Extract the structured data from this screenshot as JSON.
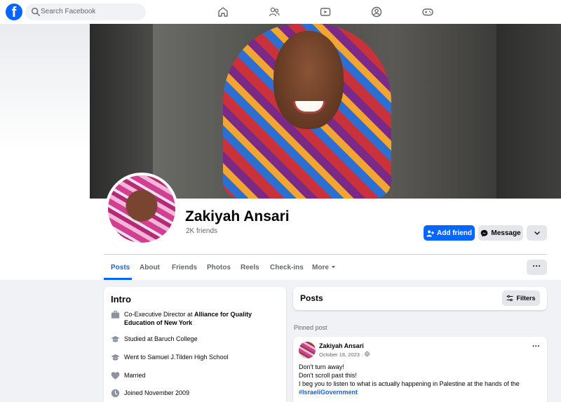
{
  "topbar": {
    "logo": "f",
    "search_placeholder": "Search Facebook",
    "nav_icons": [
      "home-icon",
      "friends-icon",
      "video-icon",
      "groups-icon",
      "gaming-icon"
    ]
  },
  "profile": {
    "name": "Zakiyah Ansari",
    "friends": "2K friends",
    "add_friend_label": "Add friend",
    "message_label": "Message"
  },
  "tabs": [
    "Posts",
    "About",
    "Friends",
    "Photos",
    "Reels",
    "Check-ins",
    "More"
  ],
  "tab_dots": "···",
  "intro": {
    "title": "Intro",
    "items": [
      {
        "icon": "briefcase-icon",
        "text": "Co-Executive Director at ",
        "bold": "Alliance for Quality Education of New York"
      },
      {
        "icon": "graduation-cap-icon",
        "text": "Studied at Baruch College"
      },
      {
        "icon": "graduation-cap-icon",
        "text": "Went to Samuel J.Tilden High School"
      },
      {
        "icon": "heart-icon",
        "text": "Married"
      },
      {
        "icon": "clock-icon",
        "text": "Joined November 2009"
      }
    ]
  },
  "posts": {
    "title": "Posts",
    "filters_label": "Filters",
    "pinned_label": "Pinned post",
    "pinned": {
      "author": "Zakiyah Ansari",
      "date": "October 18, 2023 ·",
      "lines": [
        "Don't turn away!",
        "Don't scroll past this!",
        "I beg you to listen to what is actually happening in Palestine at the hands of the"
      ],
      "hashtag": "#IsraeliGovernment"
    }
  },
  "colors": {
    "brand": "#0866ff",
    "background": "#f0f2f5",
    "secondary_button": "#e4e6eb"
  }
}
